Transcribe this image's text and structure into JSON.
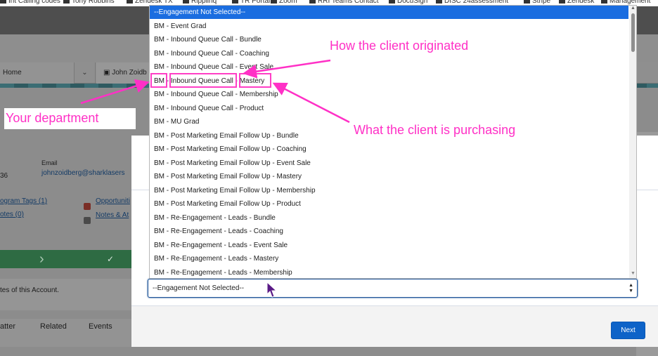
{
  "bookmarks": [
    {
      "label": "Int Calling codes",
      "icon": "bookmark-icon"
    },
    {
      "label": "Tony Robbins",
      "icon": "bookmark-icon"
    },
    {
      "label": "Zendesk TX",
      "icon": "tr-logo-icon"
    },
    {
      "label": "Ripplinq",
      "icon": "bookmark-icon"
    },
    {
      "label": "TR Portal",
      "icon": "bookmark-icon"
    },
    {
      "label": "Zoom",
      "icon": "bookmark-icon"
    },
    {
      "label": "RRI Teams Contact",
      "icon": "bookmark-icon"
    },
    {
      "label": "DocuSign",
      "icon": "bookmark-icon"
    },
    {
      "label": "DISC 24assessment",
      "icon": "bookmark-icon"
    },
    {
      "label": "Stripe",
      "icon": "bookmark-icon"
    },
    {
      "label": "Zendesk",
      "icon": "bookmark-icon"
    },
    {
      "label": "Management",
      "icon": "bookmark-icon"
    }
  ],
  "tabs": {
    "home": "Home",
    "chevron": "⌄",
    "contact": "▣ John Zoidb"
  },
  "record": {
    "email_label": "Email",
    "email_value": "johnzoidberg@sharklasers",
    "number_fragment": "36",
    "program_tags": "ogram Tags (1)",
    "notes": "otes (0)",
    "opportunities": "Opportuniti",
    "notes_attachments": "Notes & At",
    "account_text": "tes of this Account.",
    "bottom_tabs": [
      "atter",
      "Related",
      "Events"
    ]
  },
  "dropdown": {
    "options": [
      "--Engagement Not Selected--",
      "BM - Event Grad",
      "BM - Inbound Queue Call - Bundle",
      "BM - Inbound Queue Call - Coaching",
      "BM - Inbound Queue Call - Event Sale",
      "BM - Inbound Queue Call - Mastery",
      "BM - Inbound Queue Call - Membership",
      "BM - Inbound Queue Call - Product",
      "BM - MU Grad",
      "BM - Post Marketing Email Follow Up - Bundle",
      "BM - Post Marketing Email Follow Up - Coaching",
      "BM - Post Marketing Email Follow Up - Event Sale",
      "BM - Post Marketing Email Follow Up - Mastery",
      "BM - Post Marketing Email Follow Up - Membership",
      "BM - Post Marketing Email Follow Up - Product",
      "BM - Re-Engagement - Leads - Bundle",
      "BM - Re-Engagement - Leads - Coaching",
      "BM - Re-Engagement - Leads - Event Sale",
      "BM - Re-Engagement - Leads - Mastery",
      "BM - Re-Engagement - Leads - Membership"
    ],
    "selected_index": 0
  },
  "select_field": {
    "value": "--Engagement Not Selected--"
  },
  "modal": {
    "next_label": "Next",
    "close_label": "✕"
  },
  "annotations": {
    "origin": "How the client originated",
    "department": "Your department",
    "purchase": "What the client is purchasing"
  },
  "colors": {
    "annotation": "#ff30c6",
    "selected_option": "#1a6de0",
    "next_button": "#0e63c8"
  }
}
